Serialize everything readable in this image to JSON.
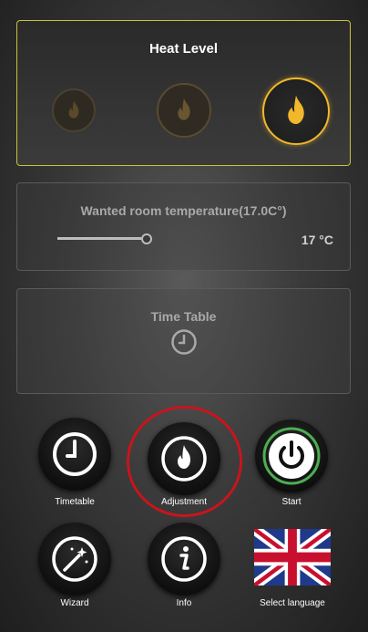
{
  "heat_panel": {
    "title": "Heat Level",
    "selected_level": 3,
    "levels": 3
  },
  "temperature": {
    "title": "Wanted room temperature(17.0C°)",
    "value_display": "17 °C",
    "slider_fraction": 0.3
  },
  "time_table": {
    "title": "Time Table"
  },
  "buttons": {
    "timetable": "Timetable",
    "adjustment": "Adjustment",
    "start": "Start",
    "wizard": "Wizard",
    "info": "Info",
    "select_language": "Select language"
  },
  "icons": {
    "flame": "flame-icon",
    "clock": "clock-icon",
    "power": "power-icon",
    "wand": "magic-wand-icon",
    "info": "info-icon",
    "flag": "uk-flag-icon"
  },
  "colors": {
    "accent_yellow": "#f0b82a",
    "panel_border_active": "#c9c23a",
    "start_ring": "#4caf50",
    "highlight_red": "#c9141c"
  }
}
